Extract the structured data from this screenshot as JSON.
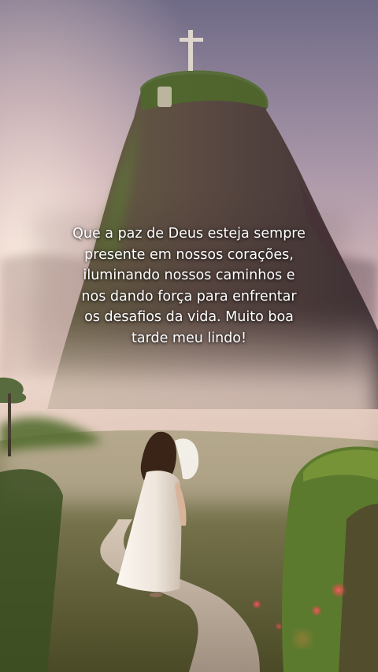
{
  "message": {
    "lines": [
      "Que a paz de Deus esteja sempre",
      "presente em nossos corações,",
      "iluminando nossos caminhos e",
      "nos dando força para enfrentar",
      "os desafios da vida. Muito boa",
      "tarde meu lindo!"
    ]
  },
  "scene": {
    "icons": [
      "cross-icon",
      "statue-icon",
      "woman-figure"
    ],
    "colors": {
      "sky_top": "#6f6a86",
      "sky_glow": "#f4d8cf",
      "rock": "#5a4a44",
      "mist": "#e9d3c8",
      "dress": "#f3ece4",
      "hair": "#3a2418",
      "foliage": "#4f6a2a",
      "path": "#cbb8a7",
      "bokeh": "#ff3b4a"
    }
  }
}
